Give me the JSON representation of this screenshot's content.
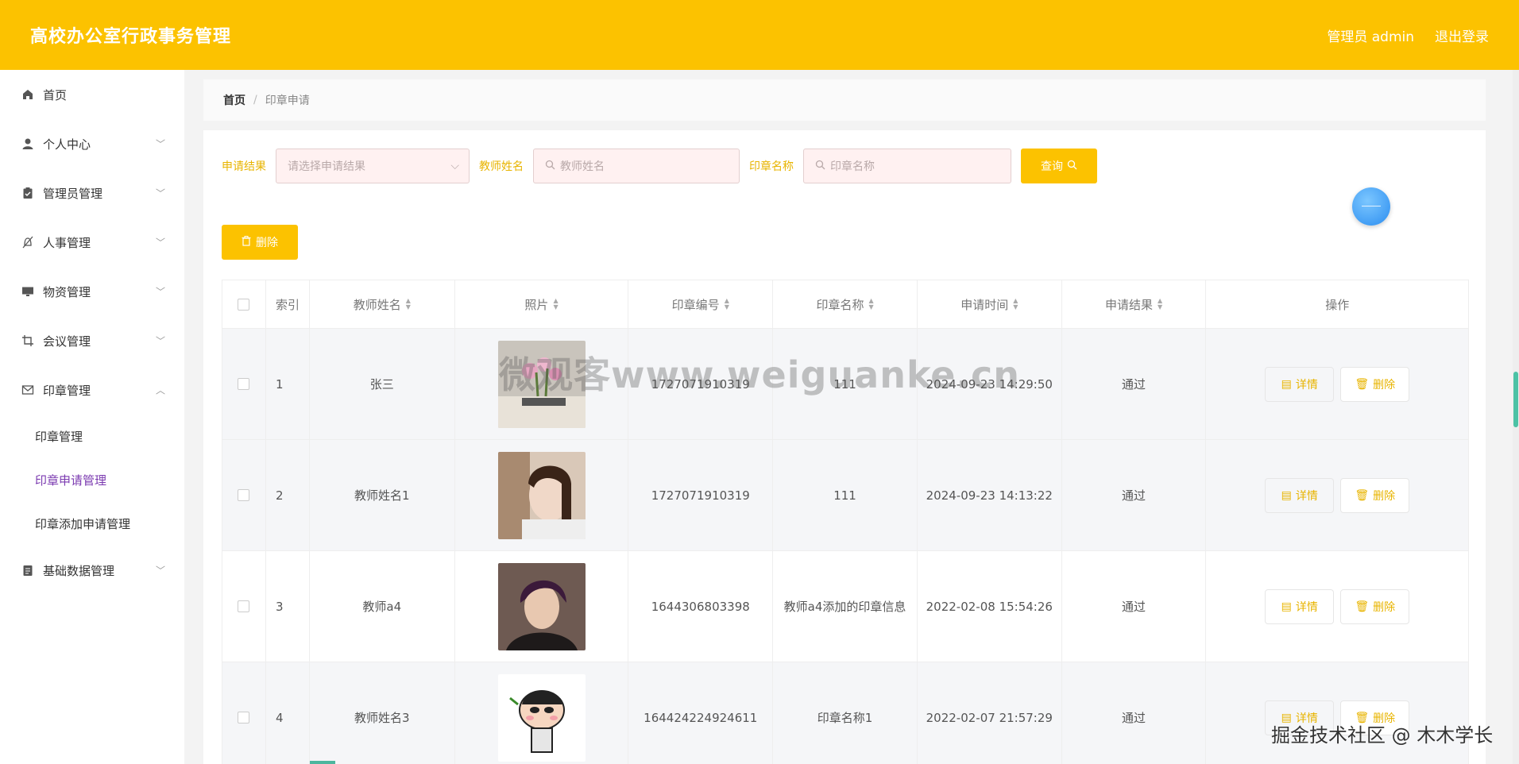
{
  "header": {
    "title": "高校办公室行政事务管理",
    "user_label": "管理员 admin",
    "logout_label": "退出登录"
  },
  "sidebar": {
    "items": [
      {
        "label": "首页",
        "icon": "home-icon"
      },
      {
        "label": "个人中心",
        "icon": "user-icon"
      },
      {
        "label": "管理员管理",
        "icon": "clipboard-icon"
      },
      {
        "label": "人事管理",
        "icon": "bell-off-icon"
      },
      {
        "label": "物资管理",
        "icon": "monitor-icon"
      },
      {
        "label": "会议管理",
        "icon": "crop-icon"
      },
      {
        "label": "印章管理",
        "icon": "mail-icon"
      },
      {
        "label": "基础数据管理",
        "icon": "document-icon"
      }
    ],
    "submenu": [
      {
        "label": "印章管理"
      },
      {
        "label": "印章申请管理"
      },
      {
        "label": "印章添加申请管理"
      }
    ]
  },
  "breadcrumb": {
    "home": "首页",
    "separator": "/",
    "current": "印章申请"
  },
  "filters": {
    "result_label": "申请结果",
    "result_placeholder": "请选择申请结果",
    "teacher_label": "教师姓名",
    "teacher_placeholder": "教师姓名",
    "seal_label": "印章名称",
    "seal_placeholder": "印章名称",
    "query_label": "查询"
  },
  "delete_label": "删除",
  "table": {
    "headers": [
      "索引",
      "教师姓名",
      "照片",
      "印章编号",
      "印章名称",
      "申请时间",
      "申请结果",
      "操作"
    ],
    "rows": [
      {
        "index": "1",
        "teacher": "张三",
        "seal_no": "1727071910319",
        "seal_name": "111",
        "time": "2024-09-23 14:29:50",
        "result": "通过"
      },
      {
        "index": "2",
        "teacher": "教师姓名1",
        "seal_no": "1727071910319",
        "seal_name": "111",
        "time": "2024-09-23 14:13:22",
        "result": "通过"
      },
      {
        "index": "3",
        "teacher": "教师a4",
        "seal_no": "1644306803398",
        "seal_name": "教师a4添加的印章信息",
        "time": "2022-02-08 15:54:26",
        "result": "通过"
      },
      {
        "index": "4",
        "teacher": "教师姓名3",
        "seal_no": "164424224924611",
        "seal_name": "印章名称1",
        "time": "2022-02-07 21:57:29",
        "result": "通过"
      }
    ],
    "detail_label": "详情",
    "delete_label": "删除"
  },
  "watermark": "微观客www.weiguanke.cn",
  "corner_mark": "掘金技术社区 @ 木木学长",
  "colors": {
    "brand": "#fcc200",
    "active_sub": "#7b3ab0",
    "accent_text": "#e8b400"
  }
}
